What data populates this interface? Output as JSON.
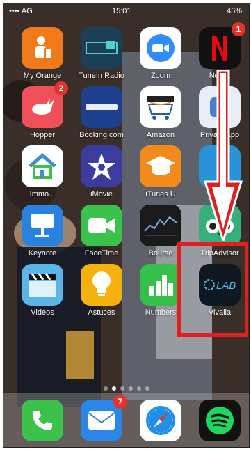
{
  "status_bar": {
    "carrier": "•••• AG",
    "time": "15:01",
    "battery": "45%"
  },
  "apps": [
    {
      "label": "My Orange",
      "icon": "orange-person-icon",
      "color": "#f07a1a",
      "badge": ""
    },
    {
      "label": "TuneIn Radio",
      "icon": "tunein-icon",
      "color": "#1b3f57",
      "badge": ""
    },
    {
      "label": "Zoom",
      "icon": "zoom-camera-icon",
      "color": "#ffffff",
      "badge": ""
    },
    {
      "label": "Netflix",
      "icon": "netflix-icon",
      "color": "#111111",
      "badge": "1"
    },
    {
      "label": "Hopper",
      "icon": "hopper-bunny-icon",
      "color": "#f0505a",
      "badge": "2"
    },
    {
      "label": "Booking.com",
      "icon": "booking-icon",
      "color": "#1f3f8f",
      "badge": ""
    },
    {
      "label": "Amazon",
      "icon": "amazon-cart-icon",
      "color": "#ffffff",
      "badge": ""
    },
    {
      "label": "Private App",
      "icon": "app-icon",
      "color": "#e8eef8",
      "badge": ""
    },
    {
      "label": "Immo...",
      "icon": "house-icon",
      "color": "#ffffff",
      "badge": ""
    },
    {
      "label": "iMovie",
      "icon": "imovie-star-icon",
      "color": "#3a3d9e",
      "badge": ""
    },
    {
      "label": "iTunes U",
      "icon": "graduation-cap-icon",
      "color": "#f28a1c",
      "badge": ""
    },
    {
      "label": "",
      "icon": "blue-app-icon",
      "color": "#2a92d8",
      "badge": ""
    },
    {
      "label": "Keynote",
      "icon": "keynote-icon",
      "color": "#2a82e0",
      "badge": ""
    },
    {
      "label": "FaceTime",
      "icon": "facetime-icon",
      "color": "#3ac24a",
      "badge": ""
    },
    {
      "label": "Bourse",
      "icon": "stocks-icon",
      "color": "#1a1a1a",
      "badge": ""
    },
    {
      "label": "TripAdvisor",
      "icon": "tripadvisor-owl-icon",
      "color": "#34b07a",
      "badge": ""
    },
    {
      "label": "Vidéos",
      "icon": "clapperboard-icon",
      "color": "#5bb6e8",
      "badge": ""
    },
    {
      "label": "Astuces",
      "icon": "lightbulb-icon",
      "color": "#f5b20c",
      "badge": ""
    },
    {
      "label": "Numbers",
      "icon": "numbers-chart-icon",
      "color": "#34c04a",
      "badge": ""
    },
    {
      "label": "Vivalia",
      "icon": "vivalia-lab-icon",
      "color": "#0e1820",
      "badge": ""
    }
  ],
  "page_dots": {
    "count": 6,
    "active": 1
  },
  "dock": [
    {
      "label": "Phone",
      "icon": "phone-icon",
      "color": "#3ac24a",
      "badge": ""
    },
    {
      "label": "Mail",
      "icon": "mail-icon",
      "color": "#2a86e8",
      "badge": "7"
    },
    {
      "label": "Safari",
      "icon": "safari-compass-icon",
      "color": "#ffffff",
      "badge": ""
    },
    {
      "label": "Spotify",
      "icon": "spotify-icon",
      "color": "#111111",
      "badge": ""
    }
  ],
  "annotation": {
    "color": "#e02020"
  }
}
